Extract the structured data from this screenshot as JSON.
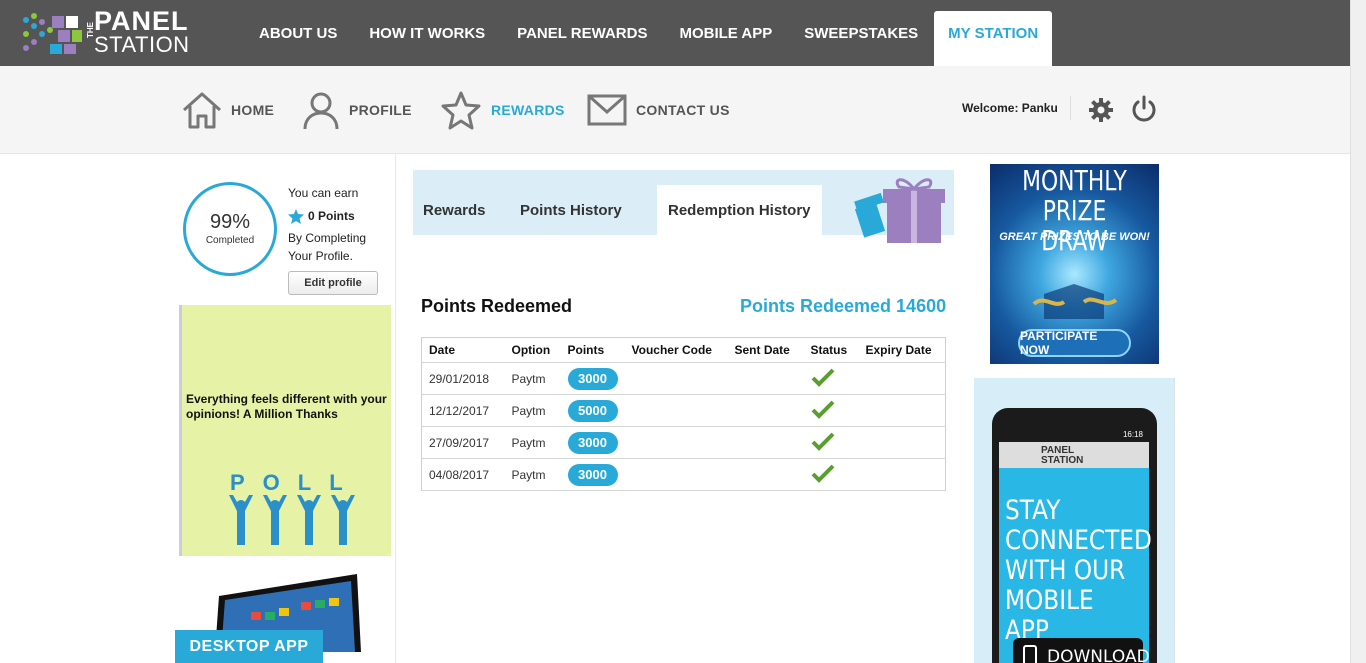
{
  "logo": {
    "the": "THE",
    "panel": "PANEL",
    "station": "STATION"
  },
  "topnav": [
    {
      "label": "ABOUT US"
    },
    {
      "label": "HOW IT WORKS"
    },
    {
      "label": "PANEL REWARDS"
    },
    {
      "label": "MOBILE APP"
    },
    {
      "label": "SWEEPSTAKES"
    },
    {
      "label": "MY STATION",
      "active": true
    }
  ],
  "subnav": {
    "home": "HOME",
    "profile": "PROFILE",
    "rewards": "REWARDS",
    "contact": "CONTACT US",
    "welcome": "Welcome: Panku"
  },
  "profile_widget": {
    "percent": "99%",
    "completed": "Completed",
    "you_can_earn": "You can earn",
    "points": "0 Points",
    "by_completing": "By Completing Your Profile.",
    "edit_button": "Edit profile"
  },
  "poll_ad": {
    "text": "Everything feels different with your opinions! A Million Thanks",
    "word": "POLL"
  },
  "desktop_ad": {
    "label": "DESKTOP APP"
  },
  "tabs": [
    {
      "label": "Rewards"
    },
    {
      "label": "Points History"
    },
    {
      "label": "Redemption History",
      "active": true
    }
  ],
  "redeemed": {
    "title": "Points Redeemed",
    "total": "Points Redeemed 14600"
  },
  "table": {
    "headers": [
      "Date",
      "Option",
      "Points",
      "Voucher Code",
      "Sent Date",
      "Status",
      "Expiry Date"
    ],
    "rows": [
      {
        "date": "29/01/2018",
        "option": "Paytm",
        "points": "3000",
        "voucher": "",
        "sent": "",
        "status": "done",
        "expiry": ""
      },
      {
        "date": "12/12/2017",
        "option": "Paytm",
        "points": "5000",
        "voucher": "",
        "sent": "",
        "status": "done",
        "expiry": ""
      },
      {
        "date": "27/09/2017",
        "option": "Paytm",
        "points": "3000",
        "voucher": "",
        "sent": "",
        "status": "done",
        "expiry": ""
      },
      {
        "date": "04/08/2017",
        "option": "Paytm",
        "points": "3000",
        "voucher": "",
        "sent": "",
        "status": "done",
        "expiry": ""
      }
    ]
  },
  "prize_ad": {
    "title": "MONTHLY PRIZE DRAW",
    "subtitle": "GREAT PRIZES TO BE WON!",
    "button": "PARTICIPATE NOW"
  },
  "app_ad": {
    "logo_panel": "PANEL",
    "logo_station": "STATION",
    "time": "16:18",
    "headline": "STAY CONNECTED WITH OUR MOBILE APP",
    "download": "DOWNLOAD"
  },
  "colors": {
    "accent": "#29a9d8",
    "topbar": "#555555",
    "check": "#5a9e2f"
  },
  "icons": [
    "home-icon",
    "profile-icon",
    "star-icon",
    "mail-icon",
    "gear-icon",
    "power-icon",
    "check-icon",
    "gift-icon"
  ]
}
